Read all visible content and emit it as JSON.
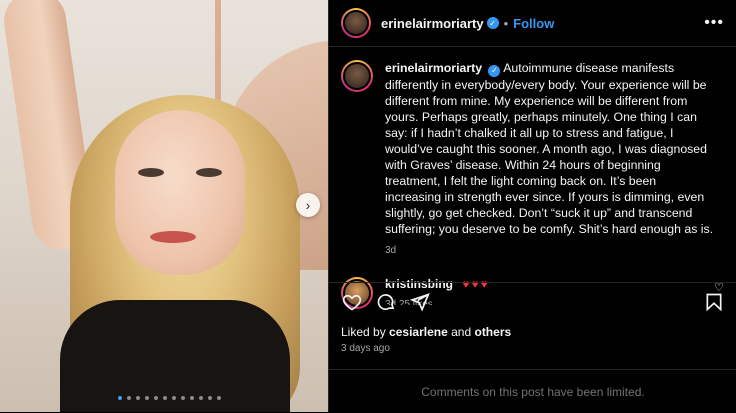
{
  "post": {
    "username": "erinelairmoriarty",
    "follow_label": "Follow",
    "separator": "•",
    "more_glyph": "•••",
    "verified_glyph": "✓"
  },
  "caption": {
    "username": "erinelairmoriarty",
    "text": "Autoimmune disease manifests differently in everybody/every body. Your experience will be different from mine. My experience will be different from yours. Perhaps greatly, perhaps minutely. One thing I can say: if I hadn’t chalked it all up to stress and fatigue, I would’ve caught this sooner. A month ago, I was diagnosed with Graves’ disease. Within 24 hours of beginning treatment, I felt the light coming back on. It’s been increasing in strength ever since. If yours is dimming, even slightly, go get checked. Don’t “suck it up” and transcend suffering; you deserve to be comfy. Shit’s hard enough as is.",
    "age": "3d"
  },
  "comment": {
    "username": "kristinsbing",
    "hearts": "♥♥♥",
    "meta": "3d   25 likes",
    "like_glyph": "♡"
  },
  "likes": {
    "prefix": "Liked by",
    "user": "cesiarlene",
    "and": "and",
    "others": "others"
  },
  "timestamp": "3 days ago",
  "comments_limited": "Comments on this post have been limited.",
  "media": {
    "next_glyph": "›",
    "carousel_count": 12,
    "carousel_active": 1
  },
  "colors": {
    "accent": "#3797f0",
    "heart": "#ff3040",
    "muted": "#a8a8a8"
  }
}
